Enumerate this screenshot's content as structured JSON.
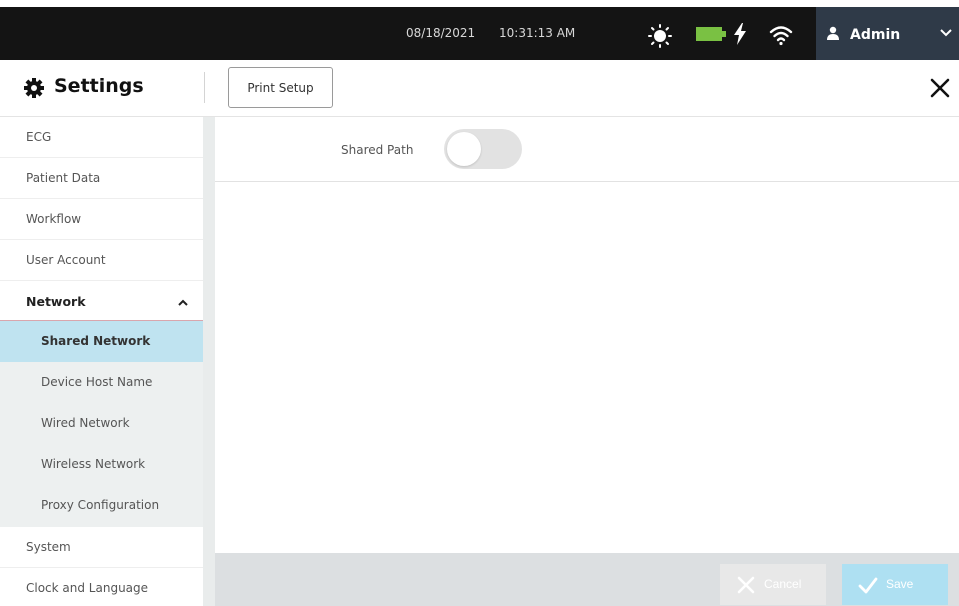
{
  "status_bar": {
    "date": "08/18/2021",
    "time": "10:31:13 AM",
    "icons": [
      "sun-icon",
      "battery-icon",
      "charging-bolt-icon",
      "wifi-icon"
    ],
    "user": {
      "name": "Admin",
      "icon": "user-icon",
      "chevron": "chevron-down-icon"
    },
    "battery_color": "#7ac143"
  },
  "header": {
    "title": "Settings",
    "title_icon": "gear-icon",
    "tab_button": "Print Setup",
    "close_icon": "close-icon"
  },
  "sidebar": {
    "items": [
      {
        "label": "ECG"
      },
      {
        "label": "Patient Data"
      },
      {
        "label": "Workflow"
      },
      {
        "label": "User Account"
      },
      {
        "label": "Network",
        "expanded": true
      }
    ],
    "network_sub_items": [
      {
        "label": "Shared Network",
        "active": true
      },
      {
        "label": "Device Host Name"
      },
      {
        "label": "Wired Network"
      },
      {
        "label": "Wireless Network"
      },
      {
        "label": "Proxy Configuration"
      }
    ],
    "after_items": [
      {
        "label": "System"
      },
      {
        "label": "Clock and Language"
      }
    ]
  },
  "content": {
    "shared_path": {
      "label": "Shared Path",
      "enabled": false
    }
  },
  "footer": {
    "cancel_label": "Cancel",
    "save_label": "Save",
    "active_color": "#bfe3f0"
  }
}
